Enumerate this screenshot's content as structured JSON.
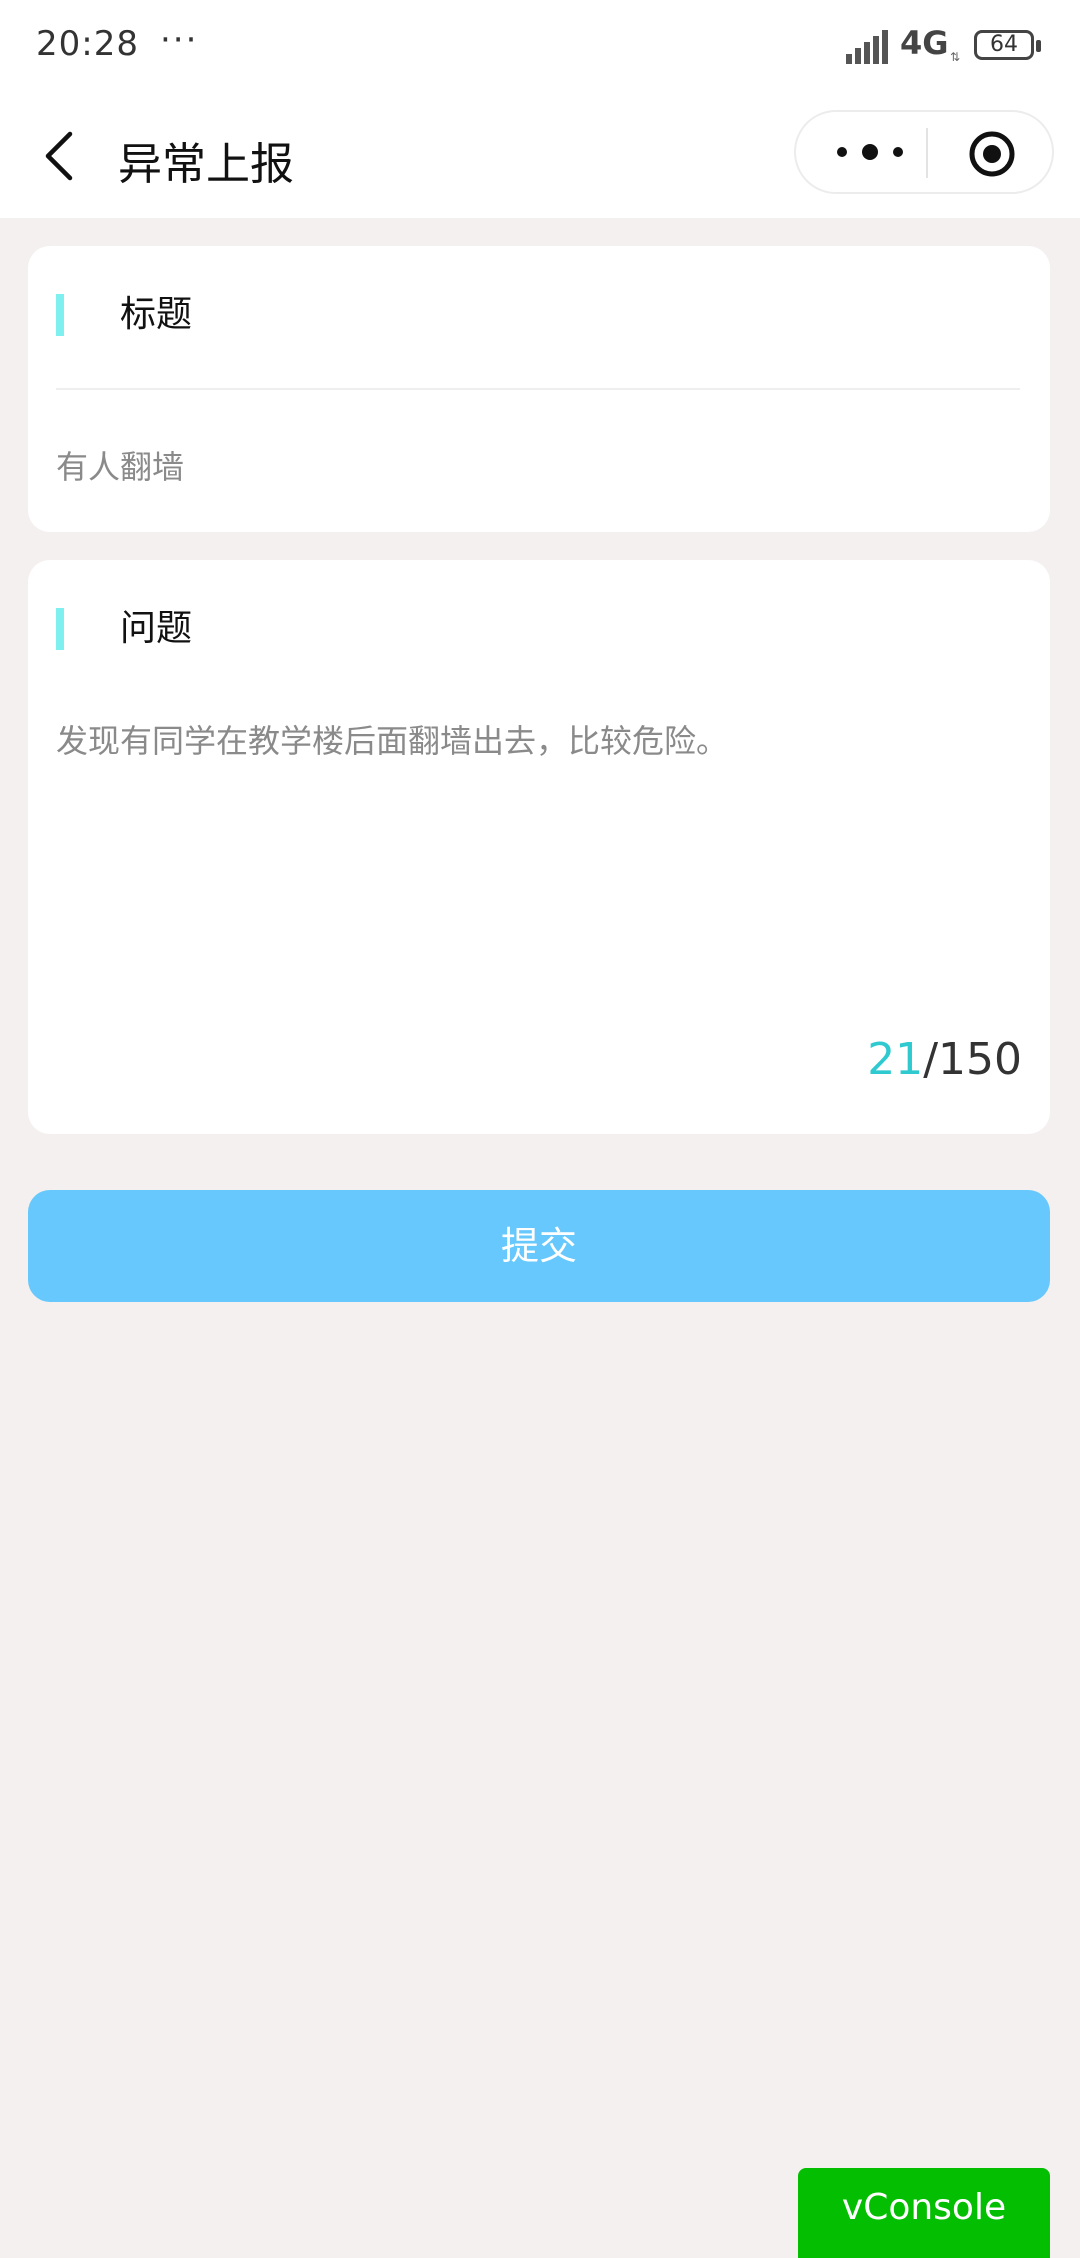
{
  "status_bar": {
    "time": "20:28",
    "dots": "···",
    "network": "4G",
    "network_arrows": "⇅",
    "battery": "64"
  },
  "nav": {
    "title": "异常上报",
    "back_icon": "chevron-left-icon",
    "more_icon": "more-dots-icon",
    "target_icon": "target-icon"
  },
  "form": {
    "title_section": {
      "label": "标题",
      "value": "有人翻墙"
    },
    "problem_section": {
      "label": "问题",
      "value": "发现有同学在教学楼后面翻墙出去，比较危险。",
      "char_count": "21",
      "char_separator": "/",
      "char_max": "150"
    },
    "submit_label": "提交"
  },
  "debug": {
    "vconsole_label": "vConsole"
  },
  "colors": {
    "accent_bar": "#7ef0f0",
    "counter_current": "#2fc9d0",
    "submit_bg": "#66c8fc",
    "vconsole_bg": "#04be02",
    "page_bg": "#f5f0f0"
  }
}
